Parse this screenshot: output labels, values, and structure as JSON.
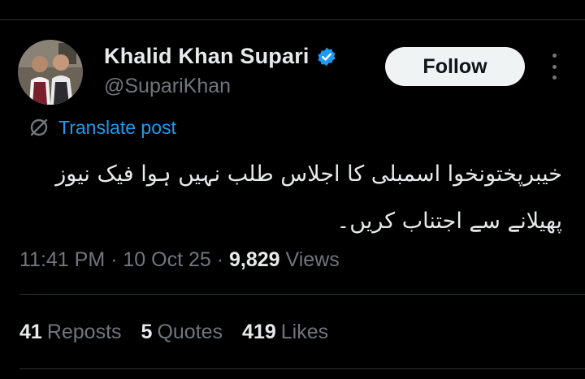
{
  "author": {
    "display_name": "Khalid Khan Supari",
    "handle": "@SupariKhan",
    "verified": true,
    "verified_color": "#1d9bf0"
  },
  "actions": {
    "follow_label": "Follow",
    "more_icon": "more-horizontal-icon"
  },
  "translate": {
    "icon": "translate-globe-icon",
    "label": "Translate post",
    "color": "#1d9bf0"
  },
  "post": {
    "text": "خیبرپختونخوا اسمبلی کا اجلاس طلب نہیں ہوا فیک نیوز پھیلانے سے اجتناب کریں۔"
  },
  "meta": {
    "time": "11:41 PM",
    "separator": " · ",
    "date": "10 Oct 25",
    "views_count": "9,829",
    "views_label": " Views"
  },
  "stats": {
    "reposts_count": "41",
    "reposts_label": "Reposts",
    "quotes_count": "5",
    "quotes_label": "Quotes",
    "likes_count": "419",
    "likes_label": "Likes"
  },
  "colors": {
    "background": "#000000",
    "text_primary": "#e7e9ea",
    "text_secondary": "#71767b",
    "follow_bg": "#eff3f4",
    "divider": "#2f3336"
  }
}
